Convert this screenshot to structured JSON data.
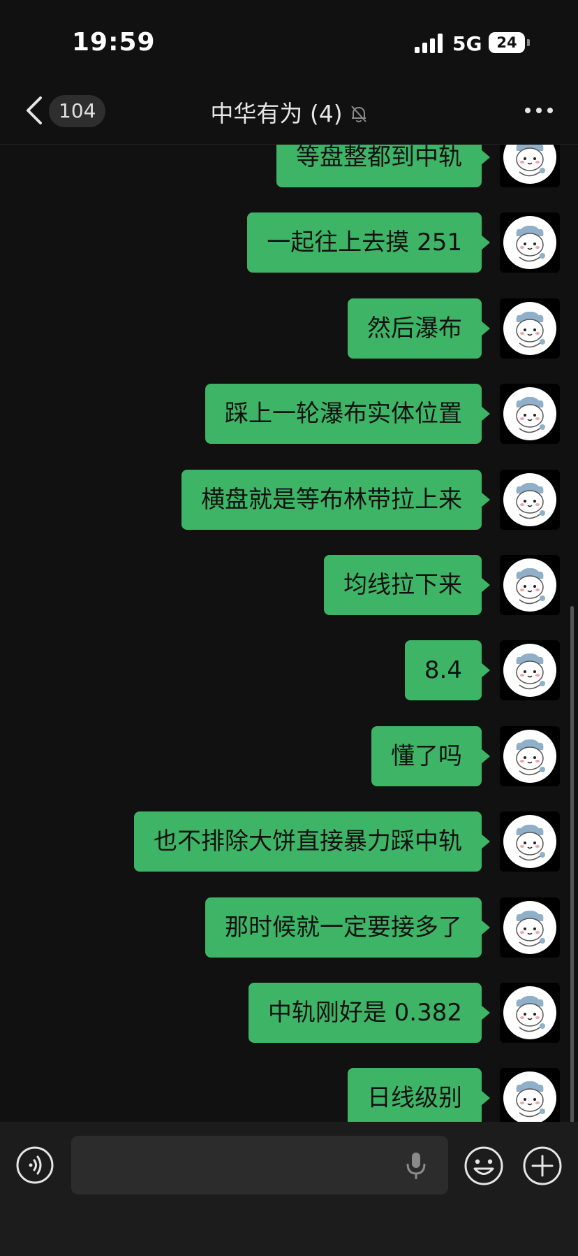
{
  "status_bar": {
    "time": "19:59",
    "network": "5G",
    "battery": "24"
  },
  "nav": {
    "unread_count": "104",
    "title": "中华有为 (4)",
    "mute_icon": "bell-slash-icon",
    "more_icon": "ellipsis-icon"
  },
  "messages": [
    {
      "text": "等盘整都到中轨"
    },
    {
      "text": "一起往上去摸 251"
    },
    {
      "text": "然后瀑布"
    },
    {
      "text": "踩上一轮瀑布实体位置"
    },
    {
      "text": "横盘就是等布林带拉上来"
    },
    {
      "text": "均线拉下来"
    },
    {
      "text": "8.4"
    },
    {
      "text": "懂了吗"
    },
    {
      "text": "也不排除大饼直接暴力踩中轨"
    },
    {
      "text": "那时候就一定要接多了"
    },
    {
      "text": "中轨刚好是 0.382"
    },
    {
      "text": "日线级别"
    }
  ],
  "input": {
    "value": "",
    "voice_icon": "voice-icon",
    "mic_icon": "microphone-icon",
    "emoji_icon": "emoji-icon",
    "plus_icon": "plus-icon"
  },
  "colors": {
    "bubble": "#3eb566",
    "background": "#111111",
    "input_bar": "#1c1c1c"
  }
}
